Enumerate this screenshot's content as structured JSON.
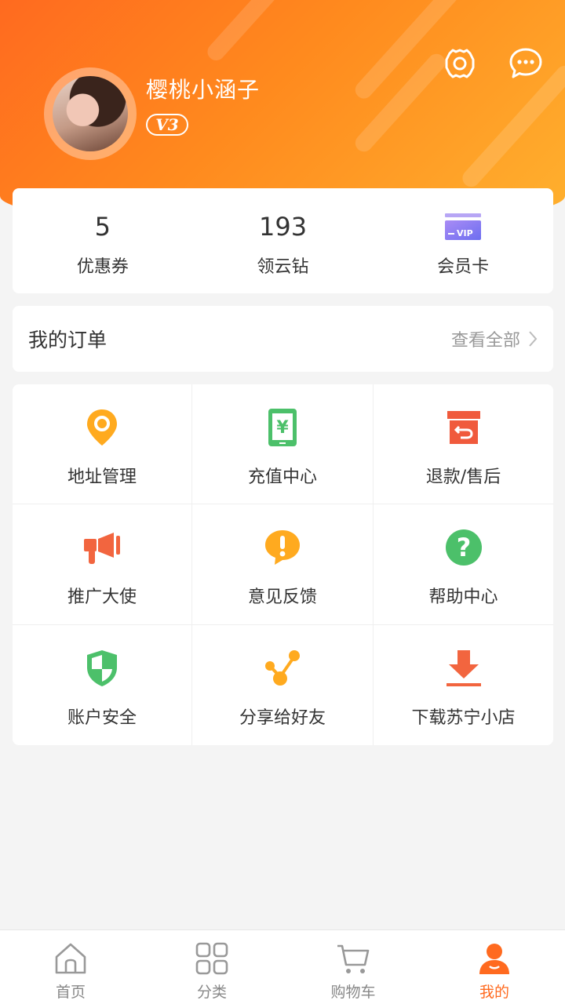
{
  "profile": {
    "username": "樱桃小涵子",
    "level_badge": "V3"
  },
  "header_icons": {
    "settings": "gear-icon",
    "messages": "chat-icon"
  },
  "stats": [
    {
      "value": "5",
      "label": "优惠券"
    },
    {
      "value": "193",
      "label": "领云钻"
    },
    {
      "value": "",
      "label": "会员卡",
      "icon_text": "VIP"
    }
  ],
  "orders": {
    "title": "我的订单",
    "view_all": "查看全部"
  },
  "services": [
    {
      "label": "地址管理",
      "icon": "location-pin-icon"
    },
    {
      "label": "充值中心",
      "icon": "phone-recharge-icon"
    },
    {
      "label": "退款/售后",
      "icon": "return-box-icon"
    },
    {
      "label": "推广大使",
      "icon": "megaphone-icon"
    },
    {
      "label": "意见反馈",
      "icon": "feedback-bubble-icon"
    },
    {
      "label": "帮助中心",
      "icon": "help-question-icon"
    },
    {
      "label": "账户安全",
      "icon": "shield-icon"
    },
    {
      "label": "分享给好友",
      "icon": "share-icon"
    },
    {
      "label": "下载苏宁小店",
      "icon": "download-icon"
    }
  ],
  "tabbar": [
    {
      "label": "首页",
      "icon": "home-icon"
    },
    {
      "label": "分类",
      "icon": "category-grid-icon"
    },
    {
      "label": "购物车",
      "icon": "cart-icon"
    },
    {
      "label": "我的",
      "icon": "profile-icon",
      "active": true
    }
  ],
  "colors": {
    "brand_orange": "#ff6a1f",
    "header_gradient_end": "#ffb12e",
    "background": "#f4f4f4"
  }
}
